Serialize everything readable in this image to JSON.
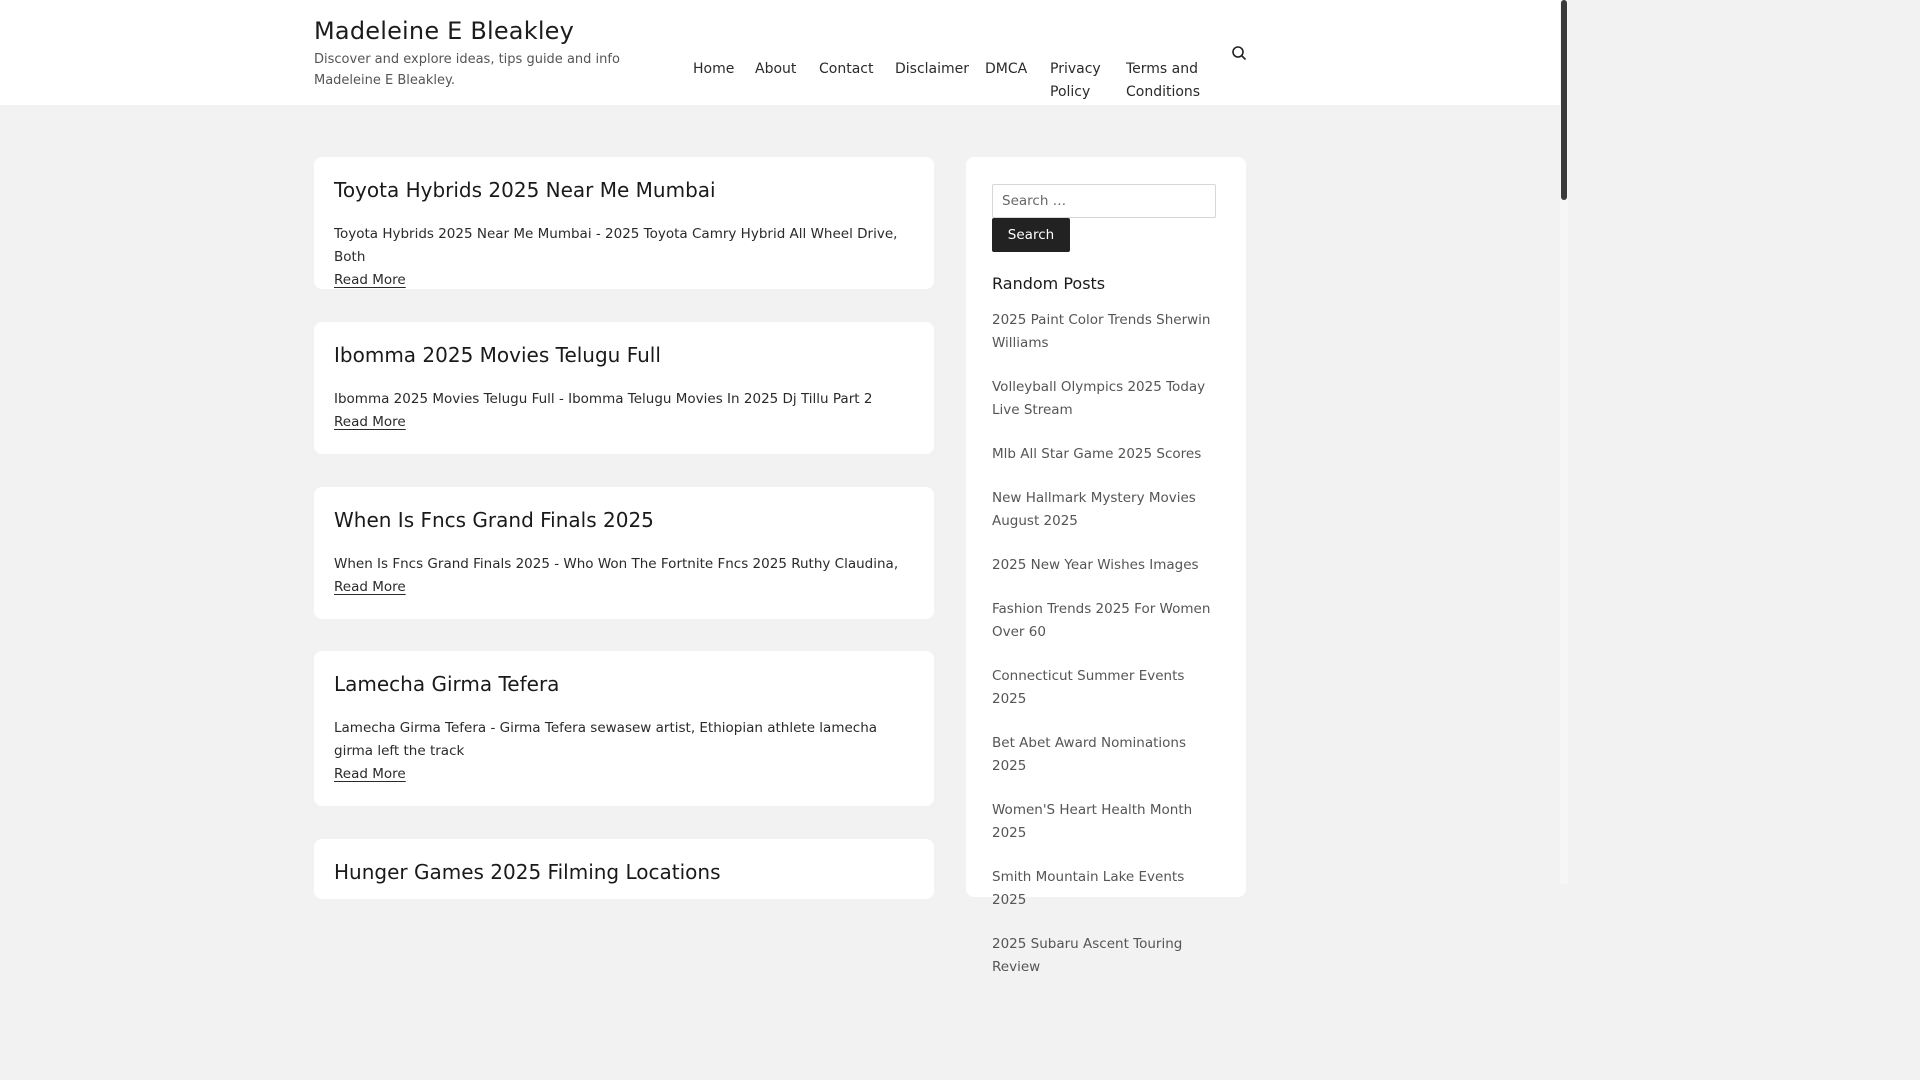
{
  "header": {
    "site_title": "Madeleine E Bleakley",
    "site_description": "Discover and explore ideas, tips guide and info Madeleine E Bleakley."
  },
  "nav": {
    "items": [
      {
        "label": "Home"
      },
      {
        "label": "About"
      },
      {
        "label": "Contact"
      },
      {
        "label": "Disclaimer"
      },
      {
        "label": "DMCA"
      },
      {
        "label": "Privacy Policy"
      },
      {
        "label": "Terms and Conditions"
      }
    ],
    "search_icon": "search-icon"
  },
  "posts": [
    {
      "title": "Toyota Hybrids 2025 Near Me Mumbai",
      "excerpt": "Toyota Hybrids 2025 Near Me Mumbai - 2025 Toyota Camry Hybrid All Wheel Drive, Both",
      "read_more": "Read More"
    },
    {
      "title": "Ibomma 2025 Movies Telugu Full",
      "excerpt": "Ibomma 2025 Movies Telugu Full - Ibomma Telugu Movies In 2025 Dj Tillu Part 2",
      "read_more": "Read More"
    },
    {
      "title": "When Is Fncs Grand Finals 2025",
      "excerpt": "When Is Fncs Grand Finals 2025 - Who Won The Fortnite Fncs 2025 Ruthy Claudina,",
      "read_more": "Read More"
    },
    {
      "title": "Lamecha Girma Tefera",
      "excerpt": "Lamecha Girma Tefera - Girma Tefera sewasew artist, Ethiopian athlete lamecha girma left the track",
      "read_more": "Read More"
    },
    {
      "title": "Hunger Games 2025 Filming Locations",
      "excerpt": "",
      "read_more": ""
    }
  ],
  "sidebar": {
    "search": {
      "placeholder": "Search …",
      "button_label": "Search"
    },
    "random_posts": {
      "title": "Random Posts",
      "items": [
        "2025 Paint Color Trends Sherwin Williams",
        "Volleyball Olympics 2025 Today Live Stream",
        "Mlb All Star Game 2025 Scores",
        "New Hallmark Mystery Movies August 2025",
        "2025 New Year Wishes Images",
        "Fashion Trends 2025 For Women Over 60",
        "Connecticut Summer Events 2025",
        "Bet Abet Award Nominations 2025",
        "Women'S Heart Health Month 2025",
        "Smith Mountain Lake Events 2025",
        "2025 Subaru Ascent Touring Review"
      ]
    }
  }
}
